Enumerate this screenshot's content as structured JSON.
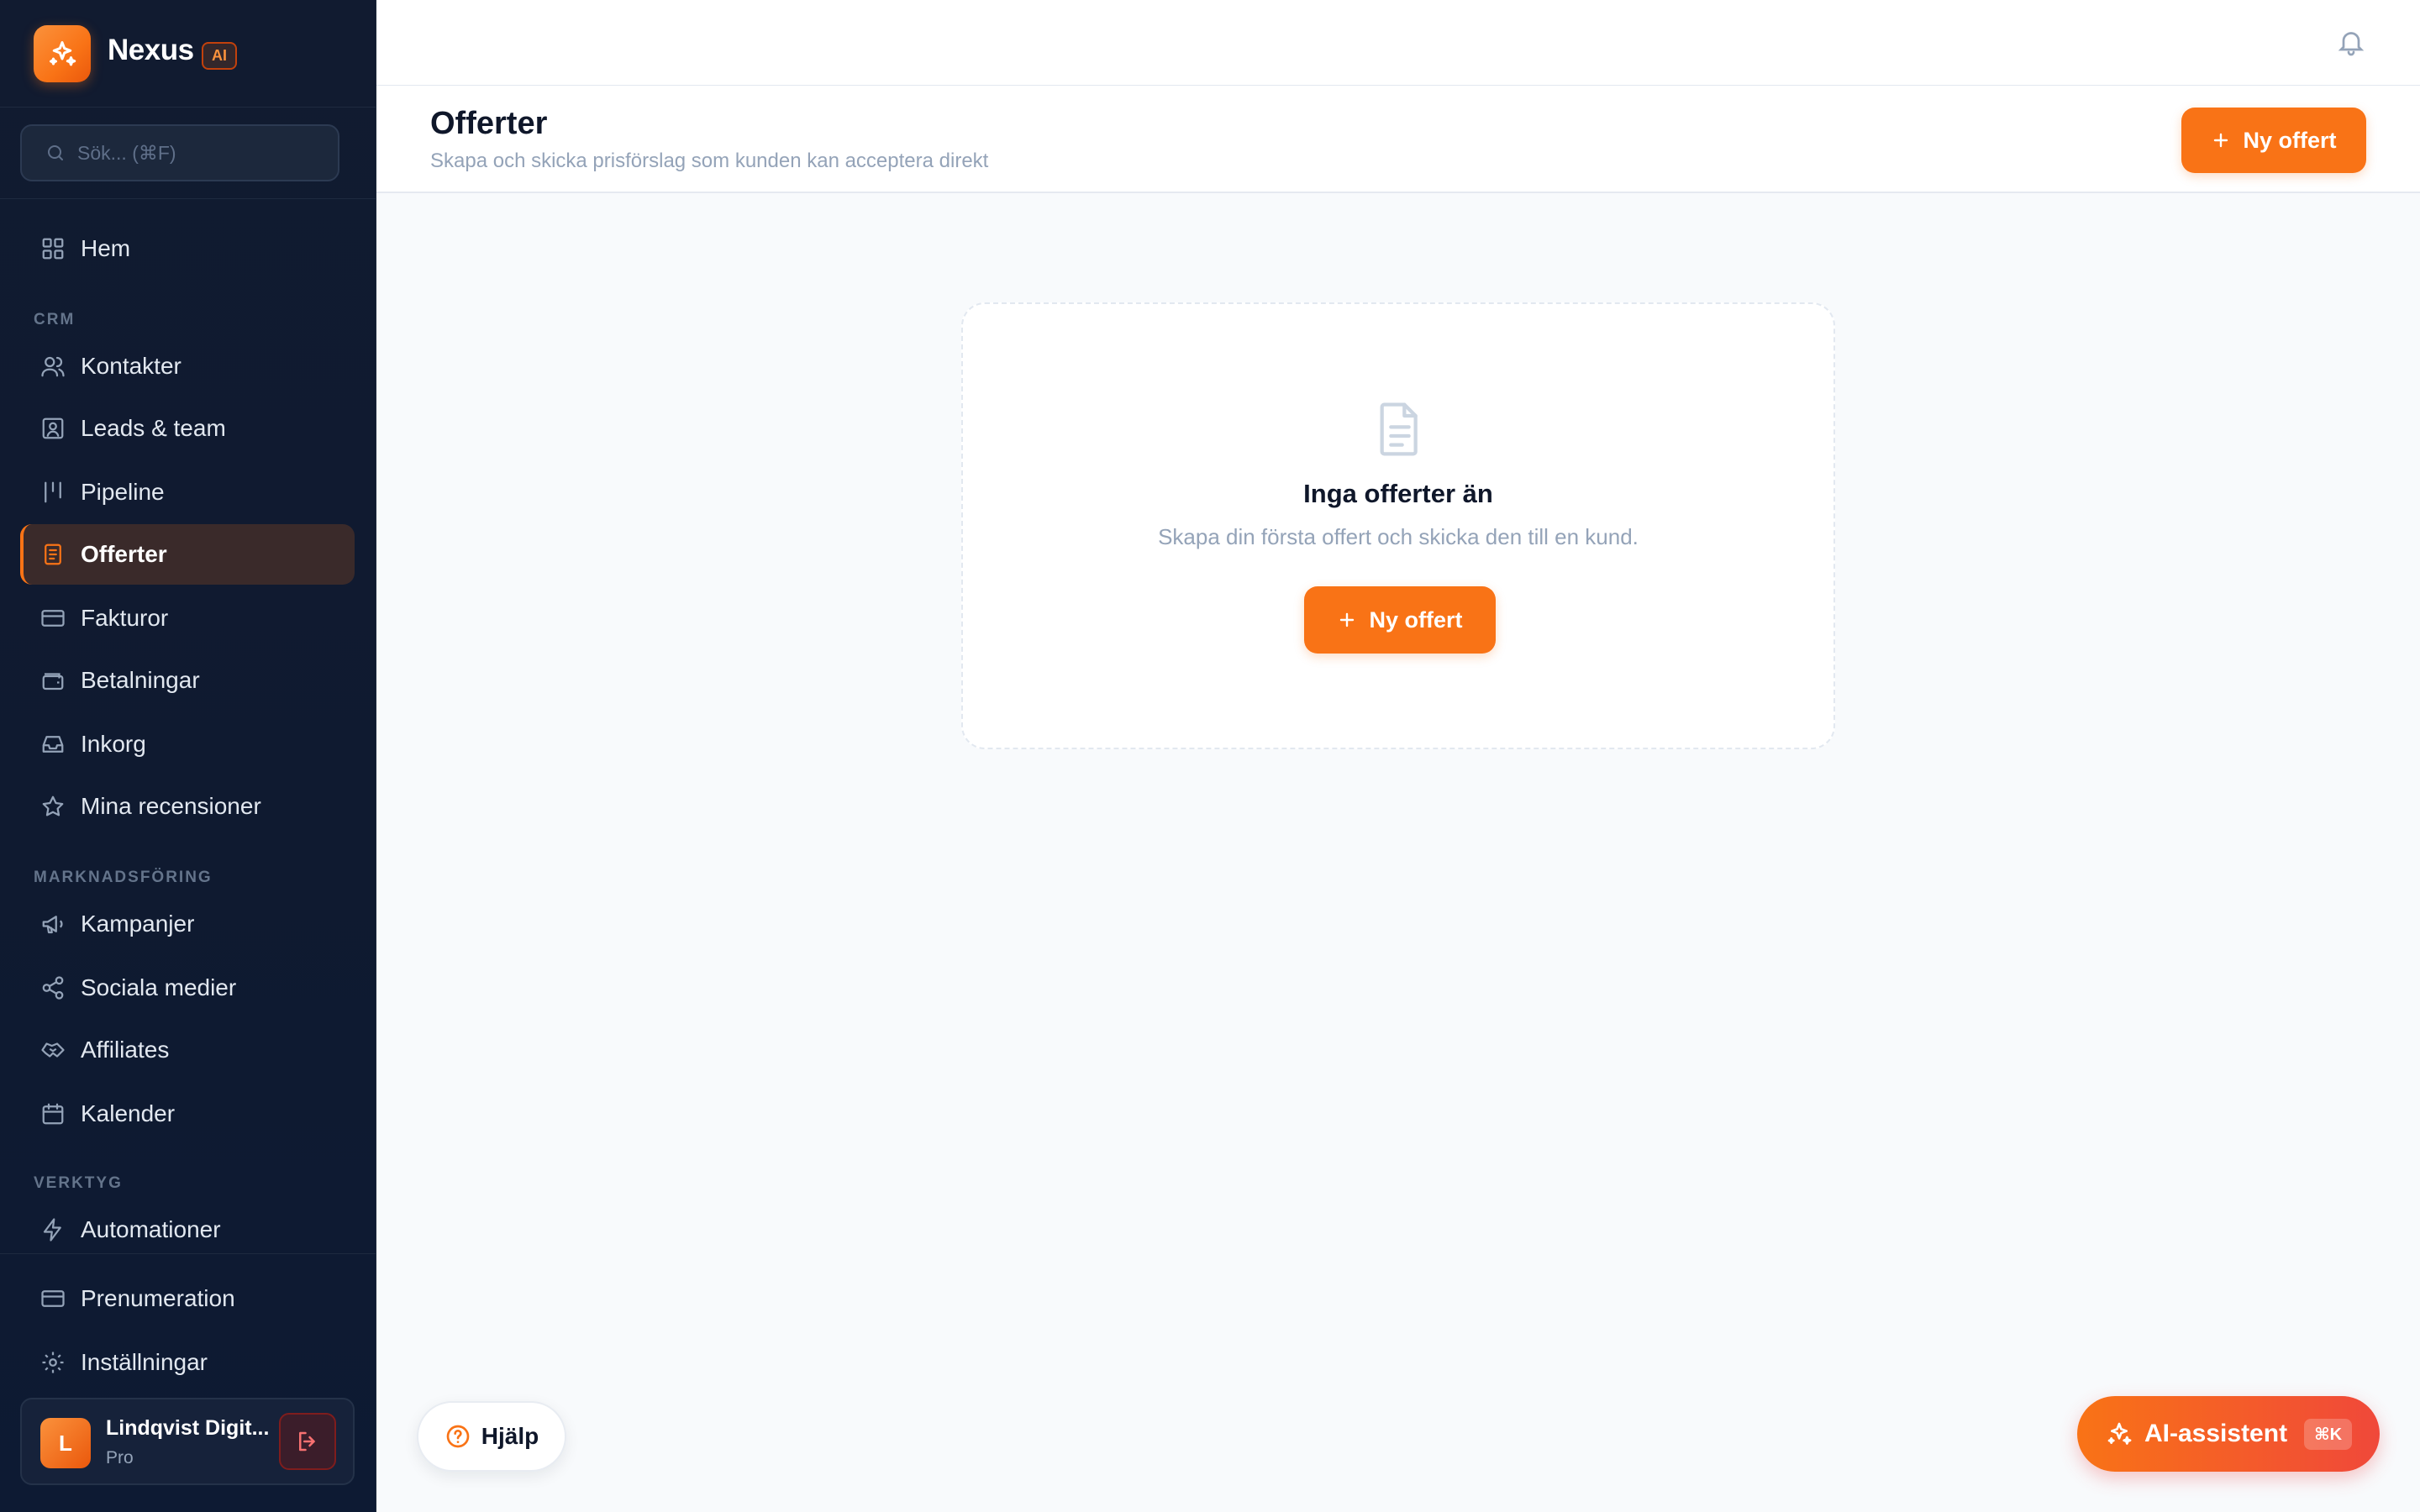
{
  "brand": {
    "name": "Nexus",
    "badge": "AI"
  },
  "search": {
    "placeholder": "Sök... (⌘F)"
  },
  "nav": {
    "home": "Hem",
    "crm_section": "CRM",
    "crm": [
      "Kontakter",
      "Leads & team",
      "Pipeline",
      "Offerter",
      "Fakturor",
      "Betalningar",
      "Inkorg",
      "Mina recensioner"
    ],
    "marketing_section": "MARKNADSFÖRING",
    "marketing": [
      "Kampanjer",
      "Sociala medier",
      "Affiliates",
      "Kalender"
    ],
    "tools_section": "VERKTYG",
    "tools": [
      "Automationer"
    ],
    "bottom": [
      "Prenumeration",
      "Inställningar"
    ],
    "active": "Offerter"
  },
  "user": {
    "initial": "L",
    "name": "Lindqvist Digit...",
    "plan": "Pro"
  },
  "header": {
    "title": "Offerter",
    "subtitle": "Skapa och skicka prisförslag som kunden kan acceptera direkt",
    "new_button": "Ny offert"
  },
  "empty_state": {
    "title": "Inga offerter än",
    "subtitle": "Skapa din första offert och skicka den till en kund.",
    "button": "Ny offert"
  },
  "help": {
    "label": "Hjälp"
  },
  "ai_assistant": {
    "label": "AI-assistent",
    "shortcut": "⌘K"
  },
  "colors": {
    "accent": "#f97316",
    "sidebar_bg": "#0f1a30",
    "active_bg": "#3a2a2a"
  }
}
